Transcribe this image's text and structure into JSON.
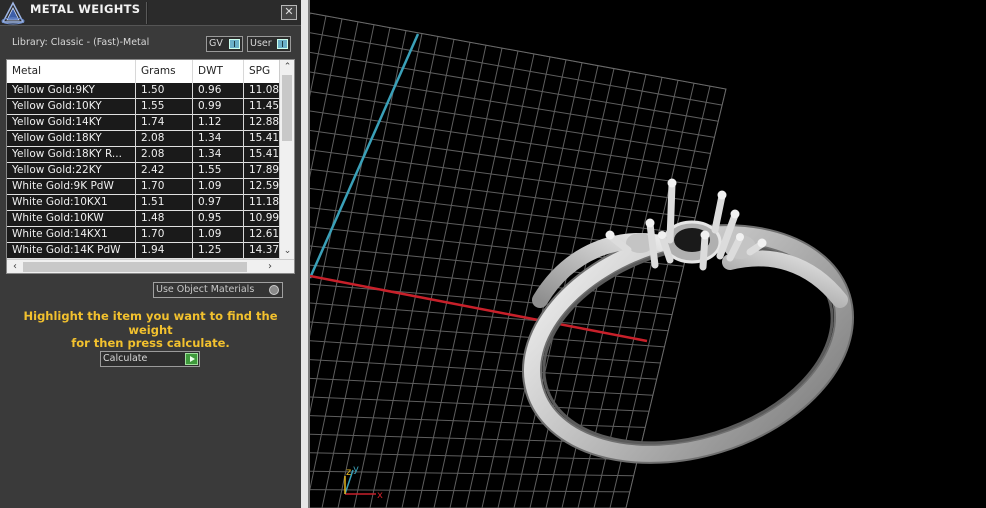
{
  "window": {
    "title": "METAL WEIGHTS",
    "close_glyph": "✕"
  },
  "library": {
    "label": "Library: Classic - (Fast)-Metal"
  },
  "toggles": [
    {
      "label": "GV",
      "checked": true
    },
    {
      "label": "User",
      "checked": true
    }
  ],
  "table": {
    "columns": [
      "Metal",
      "Grams",
      "DWT",
      "SPG"
    ],
    "rows": [
      {
        "metal": "Yellow Gold:9KY",
        "grams": "1.50",
        "dwt": "0.96",
        "spg": "11.08"
      },
      {
        "metal": "Yellow Gold:10KY",
        "grams": "1.55",
        "dwt": "0.99",
        "spg": "11.45"
      },
      {
        "metal": "Yellow Gold:14KY",
        "grams": "1.74",
        "dwt": "1.12",
        "spg": "12.88"
      },
      {
        "metal": "Yellow Gold:18KY",
        "grams": "2.08",
        "dwt": "1.34",
        "spg": "15.41"
      },
      {
        "metal": "Yellow Gold:18KY R...",
        "grams": "2.08",
        "dwt": "1.34",
        "spg": "15.41"
      },
      {
        "metal": "Yellow Gold:22KY",
        "grams": "2.42",
        "dwt": "1.55",
        "spg": "17.89"
      },
      {
        "metal": "White Gold:9K PdW",
        "grams": "1.70",
        "dwt": "1.09",
        "spg": "12.59"
      },
      {
        "metal": "White Gold:10KX1",
        "grams": "1.51",
        "dwt": "0.97",
        "spg": "11.18"
      },
      {
        "metal": "White Gold:10KW",
        "grams": "1.48",
        "dwt": "0.95",
        "spg": "10.99"
      },
      {
        "metal": "White Gold:14KX1",
        "grams": "1.70",
        "dwt": "1.09",
        "spg": "12.61"
      },
      {
        "metal": "White Gold:14K PdW",
        "grams": "1.94",
        "dwt": "1.25",
        "spg": "14.37"
      }
    ]
  },
  "scroll": {
    "up": "⌃",
    "down": "⌄",
    "left": "‹",
    "right": "›"
  },
  "use_object_materials": {
    "label": "Use Object Materials",
    "checked": false
  },
  "help_text": {
    "line1": "Highlight the item you want to find the weight",
    "line2": "for then press calculate."
  },
  "calculate": {
    "label": "Calculate"
  },
  "viewport": {
    "axis_x": "x",
    "axis_y": "y",
    "axis_z": "z",
    "colors": {
      "grid": "#5e5e5e",
      "x_axis": "#c8202a",
      "y_axis": "#3aa0b8",
      "ring": "#d6d6d6"
    }
  },
  "icons": {
    "app_logo": "triangle-logo-icon",
    "close": "close-icon",
    "go": "play-arrow-icon",
    "axis_gizmo": "axis-gizmo-icon"
  }
}
